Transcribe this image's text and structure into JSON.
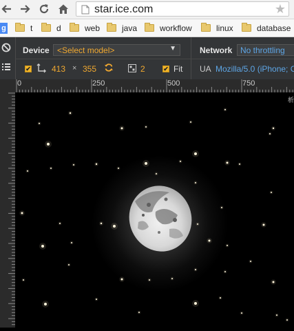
{
  "browser": {
    "url": "star.ice.com",
    "bookmarks": [
      {
        "label": "t"
      },
      {
        "label": "d"
      },
      {
        "label": "web"
      },
      {
        "label": "java"
      },
      {
        "label": "workflow"
      },
      {
        "label": "linux"
      },
      {
        "label": "database"
      }
    ]
  },
  "emulation": {
    "device_label": "Device",
    "model_placeholder": "<Select model>",
    "width": "413",
    "times": "×",
    "height": "355",
    "scale": "2",
    "fit_label": "Fit",
    "network_label": "Network",
    "throttle_value": "No throttling",
    "ua_label": "UA",
    "ua_value": "Mozilla/5.0 (iPhone; C"
  },
  "ruler": {
    "marks": [
      "0",
      "250",
      "500",
      "750"
    ]
  },
  "viewport": {
    "corner_text": "析",
    "background": "#000000",
    "moon": "moon-image"
  },
  "colors": {
    "accent_orange": "#f0a830",
    "accent_blue": "#5ea6e6",
    "toolbar_bg": "#333537"
  }
}
